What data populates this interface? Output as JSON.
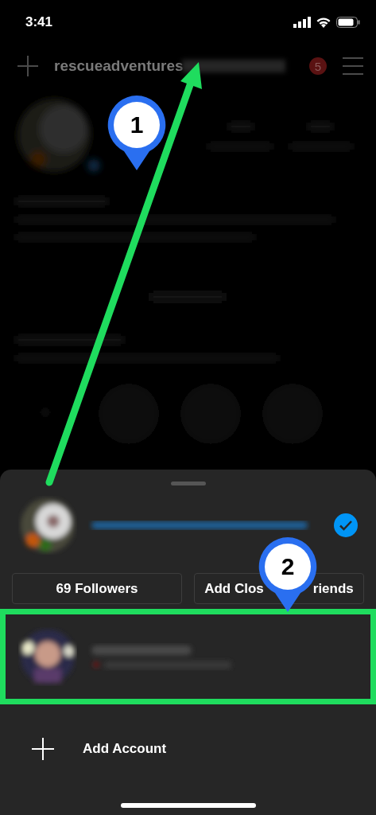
{
  "status_bar": {
    "time": "3:41"
  },
  "header": {
    "username": "rescueadventures",
    "notification_count": "5"
  },
  "sheet": {
    "accounts": [
      {
        "kind": "current",
        "selected": true,
        "highlighted": false
      },
      {
        "kind": "other",
        "selected": false,
        "highlighted": true
      }
    ],
    "buttons": [
      {
        "parts": [
          "69 Followers"
        ]
      },
      {
        "parts": [
          "Add Clos",
          "riends"
        ]
      }
    ],
    "add_account": "Add Account"
  },
  "annotations": [
    {
      "label": "1"
    },
    {
      "label": "2"
    }
  ]
}
